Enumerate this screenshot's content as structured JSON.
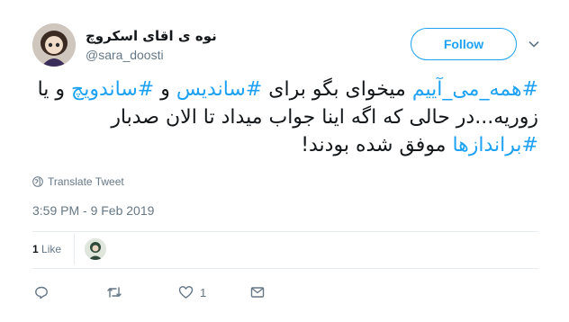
{
  "user": {
    "display_name": "نوه ی اقای اسکروچ",
    "handle": "@sara_doosti"
  },
  "follow_label": "Follow",
  "tweet": {
    "segments": [
      {
        "text": "#همه_می_آییم",
        "hashtag": true
      },
      {
        "text": " میخوای بگو برای ",
        "hashtag": false
      },
      {
        "text": "#ساندیس",
        "hashtag": true
      },
      {
        "text": " و ",
        "hashtag": false
      },
      {
        "text": "#ساندویچ",
        "hashtag": true
      },
      {
        "text": " و یا زوریه...در حالی که اگه اینا جواب میداد تا الان صدبار ",
        "hashtag": false
      },
      {
        "text": "#براندازها",
        "hashtag": true
      },
      {
        "text": " موفق شده بودند!",
        "hashtag": false
      }
    ]
  },
  "translate_label": "Translate Tweet",
  "timestamp": "3:59 PM - 9 Feb 2019",
  "stats": {
    "likes_count": "1",
    "likes_label": "Like"
  },
  "actions": {
    "reply_count": "",
    "retweet_count": "",
    "like_count": "1"
  },
  "colors": {
    "accent": "#1da1f2",
    "muted": "#657786",
    "text": "#14171a",
    "divider": "#e6ecf0"
  }
}
